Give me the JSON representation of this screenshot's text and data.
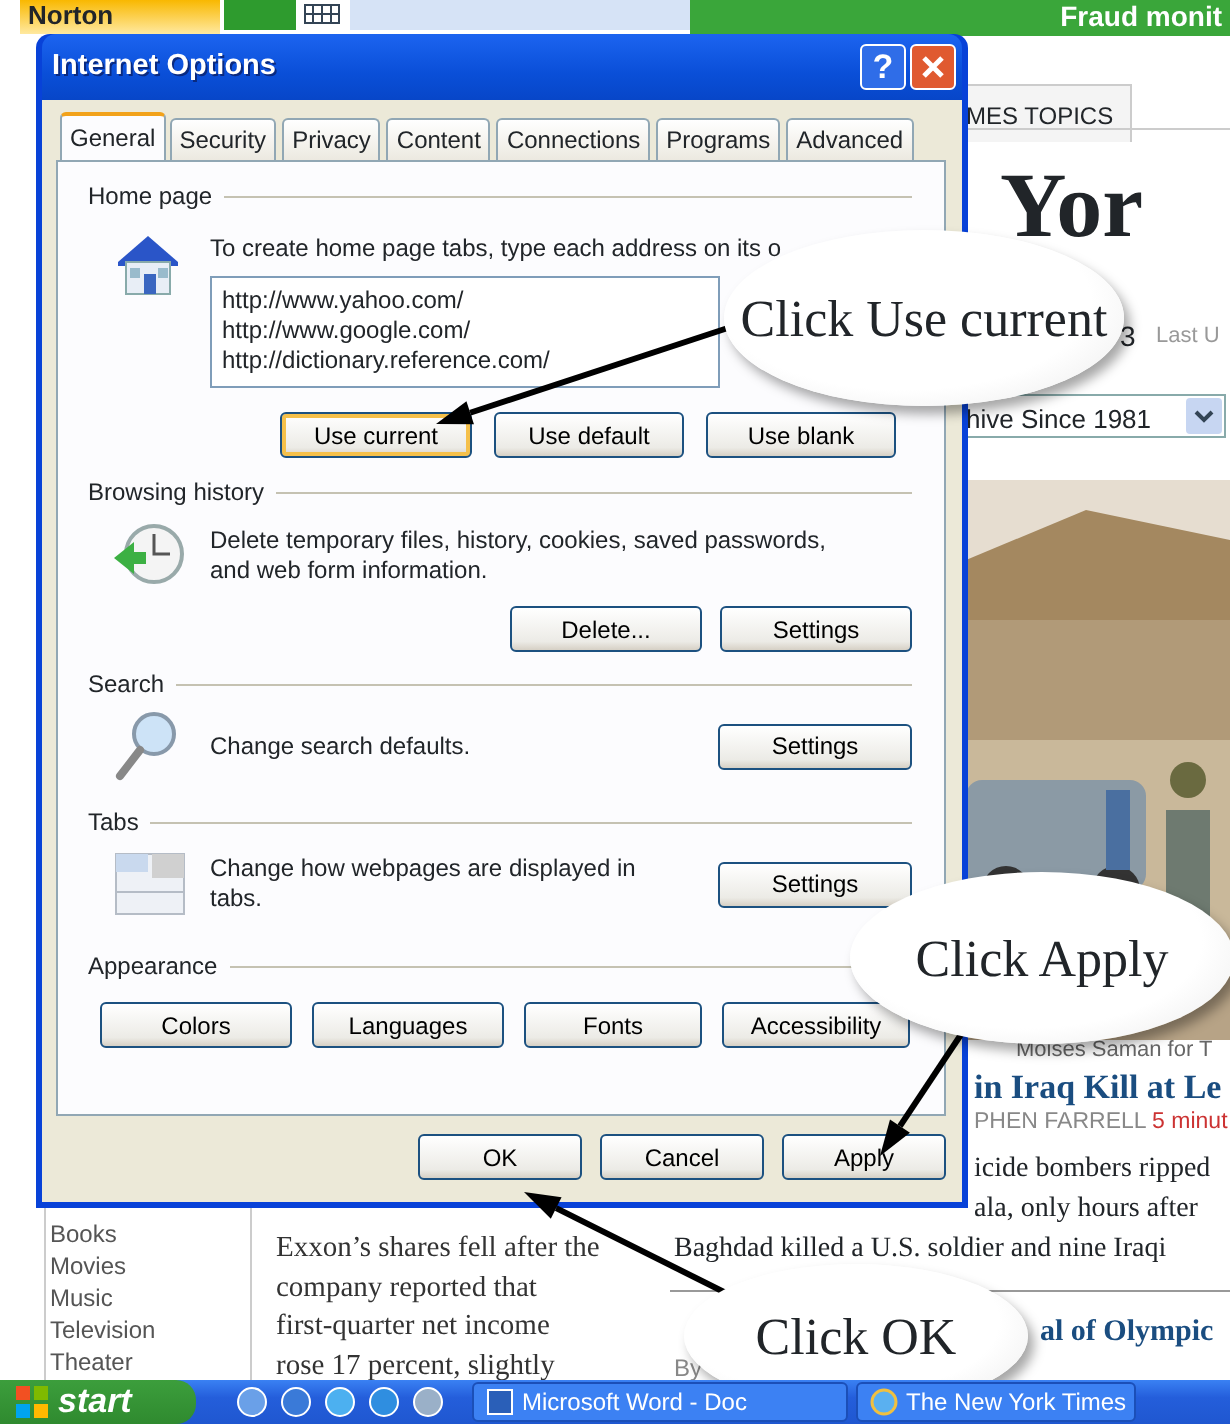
{
  "browser_toolbar": {
    "norton": "Norton",
    "alert": "Fraud monit"
  },
  "webpage": {
    "tab": "MES TOPICS",
    "logo": "Yor",
    "date_fragment": "3",
    "updated": "Last U",
    "archive_select": "hive Since 1981",
    "photo": {
      "kind": "picture"
    },
    "photo_credit": "Moises Saman for T",
    "headline": "in Iraq Kill at Le",
    "byline": "PHEN FARRELL",
    "byline_time": "5 minut",
    "story_lines": [
      "icide bombers ripped",
      "ala, only hours after",
      "Baghdad killed a U.S. soldier and nine Iraqi"
    ],
    "arts_links": [
      "Books",
      "Movies",
      "Music",
      "Television",
      "Theater"
    ],
    "exxon_lines": [
      "Exxon’s shares fell after the",
      "company reported that",
      "first-quarter net income",
      "rose 17 percent, slightly"
    ],
    "second_headline": "al of Olympic",
    "second_byline": "By"
  },
  "dialog": {
    "title": "Internet Options",
    "help": "?",
    "tabs": [
      {
        "label": "General",
        "selected": true
      },
      {
        "label": "Security",
        "selected": false
      },
      {
        "label": "Privacy",
        "selected": false
      },
      {
        "label": "Content",
        "selected": false
      },
      {
        "label": "Connections",
        "selected": false
      },
      {
        "label": "Programs",
        "selected": false
      },
      {
        "label": "Advanced",
        "selected": false
      }
    ],
    "sections": [
      {
        "kind": "home",
        "heading": "Home page",
        "description": "To create home page tabs, type each address on its o",
        "urls": [
          "http://www.yahoo.com/",
          "http://www.google.com/",
          "http://dictionary.reference.com/"
        ],
        "buttons": [
          {
            "label": "Use current",
            "focused": true
          },
          {
            "label": "Use default",
            "focused": false
          },
          {
            "label": "Use blank",
            "focused": false
          }
        ]
      },
      {
        "kind": "history",
        "heading": "Browsing history",
        "description": "Delete temporary files, history, cookies, saved passwords, and web form information.",
        "buttons": [
          {
            "label": "Delete...",
            "focused": false
          },
          {
            "label": "Settings",
            "focused": false
          }
        ]
      },
      {
        "kind": "search",
        "heading": "Search",
        "description": "Change search defaults.",
        "buttons": [
          {
            "label": "Settings",
            "focused": false
          }
        ]
      },
      {
        "kind": "tabs",
        "heading": "Tabs",
        "description": "Change how webpages are displayed in tabs.",
        "buttons": [
          {
            "label": "Settings",
            "focused": false
          }
        ]
      },
      {
        "kind": "appearance",
        "heading": "Appearance",
        "buttons": [
          {
            "label": "Colors",
            "focused": false
          },
          {
            "label": "Languages",
            "focused": false
          },
          {
            "label": "Fonts",
            "focused": false
          },
          {
            "label": "Accessibility",
            "focused": false
          }
        ]
      }
    ],
    "footer_buttons": [
      "OK",
      "Cancel",
      "Apply"
    ]
  },
  "callouts": [
    {
      "text": "Click Use current"
    },
    {
      "text": "Click Apply"
    },
    {
      "text": "Click OK"
    }
  ],
  "taskbar": {
    "start": "start",
    "tasks": [
      "Microsoft Word - Doc",
      "The New York Times"
    ]
  }
}
